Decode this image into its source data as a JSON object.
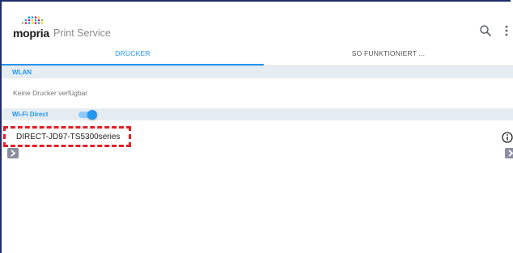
{
  "app": {
    "logo_word": "mopria",
    "logo_subtitle": "Print Service"
  },
  "tabs": [
    {
      "label": "DRUCKER",
      "active": true
    },
    {
      "label": "SO FUNKTIONIERT ...",
      "active": false
    }
  ],
  "sections": {
    "wlan": {
      "header": "WLAN",
      "empty_message": "Keine Drucker verfügbar"
    },
    "wifi_direct": {
      "header": "Wi-Fi Direct",
      "toggle_on": true,
      "printers": [
        {
          "name": "DIRECT-JD97-TS5300series"
        }
      ]
    }
  },
  "colors": {
    "accent": "#2196f3",
    "section_bg": "#e6edf2",
    "highlight": "#e41e26"
  },
  "icons": [
    "search-icon",
    "more-vert-icon",
    "info-icon",
    "chevron-right-icon"
  ]
}
